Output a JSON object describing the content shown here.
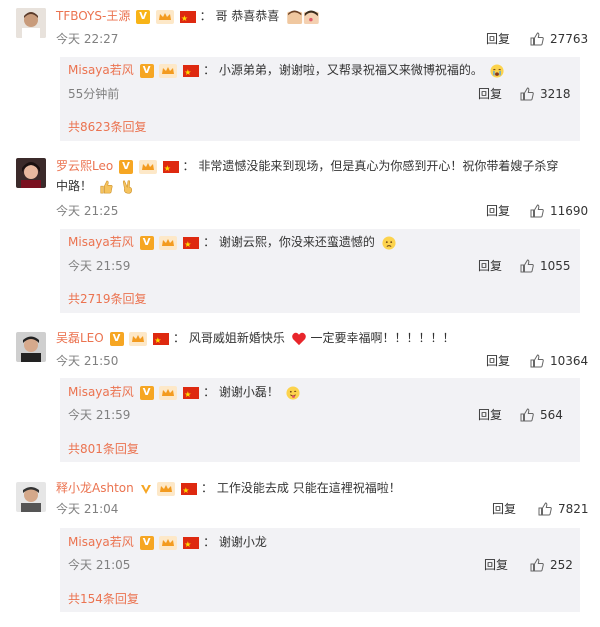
{
  "comments": [
    {
      "user": "TFBOYS-王源",
      "text": "哥 恭喜恭喜",
      "time": "今天 22:27",
      "reply_label": "回复",
      "likes": "27763",
      "reply": {
        "user": "Misaya若风",
        "text": "小源弟弟，谢谢啦，又帮录祝福又来微博祝福的。",
        "time": "55分钟前",
        "reply_label": "回复",
        "likes": "3218",
        "more": "共8623条回复"
      }
    },
    {
      "user": "罗云熙Leo",
      "text": "非常遗憾没能来到现场，但是真心为你感到开心！祝你带着嫂子杀穿中路！",
      "time": "今天 21:25",
      "reply_label": "回复",
      "likes": "11690",
      "reply": {
        "user": "Misaya若风",
        "text": "谢谢云熙，你没来还蛮遗憾的",
        "time": "今天 21:59",
        "reply_label": "回复",
        "likes": "1055",
        "more": "共2719条回复"
      }
    },
    {
      "user": "吴磊LEO",
      "text": "风哥威姐新婚快乐",
      "text2": "一定要幸福啊！！！！！！",
      "time": "今天 21:50",
      "reply_label": "回复",
      "likes": "10364",
      "reply": {
        "user": "Misaya若风",
        "text": "谢谢小磊！",
        "time": "今天 21:59",
        "reply_label": "回复",
        "likes": "564",
        "more": "共801条回复"
      }
    },
    {
      "user": "释小龙Ashton",
      "text": "工作没能去成 只能在這裡祝福啦！",
      "time": "今天 21:04",
      "reply_label": "回复",
      "likes": "7821",
      "reply": {
        "user": "Misaya若风",
        "text": "谢谢小龙",
        "time": "今天 21:05",
        "reply_label": "回复",
        "likes": "252",
        "more": "共154条回复"
      }
    }
  ],
  "colors": {
    "username": "#eb7350",
    "reply_bg": "#f2f2f5",
    "meta": "#808080"
  }
}
